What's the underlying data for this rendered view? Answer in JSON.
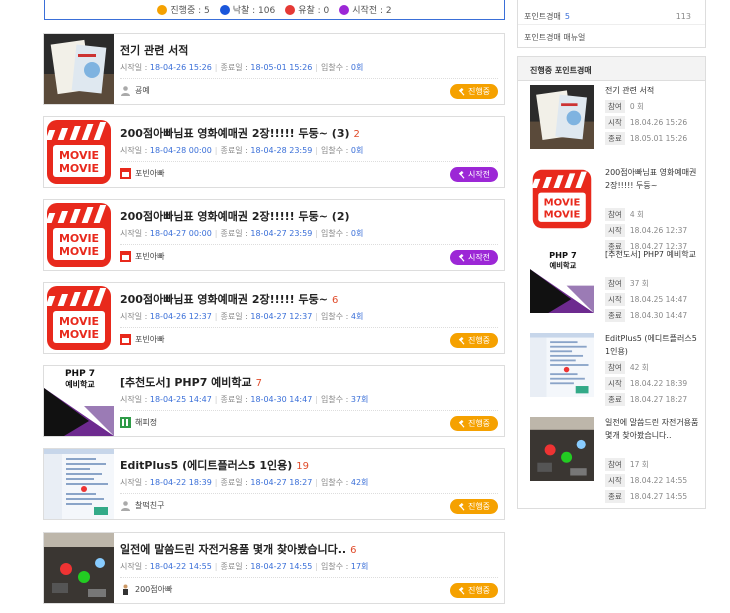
{
  "legend": {
    "items": [
      {
        "label": "진행중 : 5",
        "color": "#f5a100"
      },
      {
        "label": "낙찰 : 106",
        "color": "#1a56db"
      },
      {
        "label": "유찰 : 0",
        "color": "#e53935"
      },
      {
        "label": "시작전 : 2",
        "color": "#9c27d6"
      }
    ]
  },
  "auctions": [
    {
      "title": "전기 관련 서적",
      "count": "",
      "start_label": "시작일 :",
      "start": "18-04-26 15:26",
      "end_label": "종료일 :",
      "end": "18-05-01 15:26",
      "bids_label": "입찰수 :",
      "bids": "0회",
      "user": "굥예",
      "status": "진행중",
      "status_type": "progress",
      "thumb": "book"
    },
    {
      "title": "200점아빠님표 영화예매권 2장!!!!! 두둥~ (3)",
      "count": "2",
      "start_label": "시작일 :",
      "start": "18-04-28 00:00",
      "end_label": "종료일 :",
      "end": "18-04-28 23:59",
      "bids_label": "입찰수 :",
      "bids": "0회",
      "user": "포빈아빠",
      "status": "시작전",
      "status_type": "scheduled",
      "thumb": "movie"
    },
    {
      "title": "200점아빠님표 영화예매권 2장!!!!! 두둥~ (2)",
      "count": "",
      "start_label": "시작일 :",
      "start": "18-04-27 00:00",
      "end_label": "종료일 :",
      "end": "18-04-27 23:59",
      "bids_label": "입찰수 :",
      "bids": "0회",
      "user": "포빈아빠",
      "status": "시작전",
      "status_type": "scheduled",
      "thumb": "movie"
    },
    {
      "title": "200점아빠님표 영화예매권 2장!!!!! 두둥~",
      "count": "6",
      "start_label": "시작일 :",
      "start": "18-04-26 12:37",
      "end_label": "종료일 :",
      "end": "18-04-27 12:37",
      "bids_label": "입찰수 :",
      "bids": "4회",
      "user": "포빈아빠",
      "status": "진행중",
      "status_type": "progress",
      "thumb": "movie"
    },
    {
      "title": "[추천도서] PHP7 예비학교",
      "count": "7",
      "start_label": "시작일 :",
      "start": "18-04-25 14:47",
      "end_label": "종료일 :",
      "end": "18-04-30 14:47",
      "bids_label": "입찰수 :",
      "bids": "37회",
      "user": "해피정",
      "status": "진행중",
      "status_type": "progress",
      "thumb": "php"
    },
    {
      "title": "EditPlus5 (에디트플러스5 1인용)",
      "count": "19",
      "start_label": "시작일 :",
      "start": "18-04-22 18:39",
      "end_label": "종료일 :",
      "end": "18-04-27 18:27",
      "bids_label": "입찰수 :",
      "bids": "42회",
      "user": "찰떡친구",
      "status": "진행중",
      "status_type": "progress",
      "thumb": "editplus"
    },
    {
      "title": "일전에 말씀드린 자전거용품 몇개 찾아봤습니다..",
      "count": "6",
      "start_label": "시작일 :",
      "start": "18-04-22 14:55",
      "end_label": "종료일 :",
      "end": "18-04-27 14:55",
      "bids_label": "입찰수 :",
      "bids": "17회",
      "user": "200점아빠",
      "status": "진행중",
      "status_type": "progress",
      "thumb": "bike"
    }
  ],
  "side_top": {
    "link1": "포인트경매",
    "link1_count": "5",
    "link1_num": "113",
    "link2": "포인트경매 매뉴얼"
  },
  "side_panel": {
    "heading": "진행중 포인트경매",
    "labels": {
      "bid": "참여",
      "start": "시작",
      "end": "종료"
    },
    "items": [
      {
        "title": "전기 관련 서적",
        "bids": "0 회",
        "start": "18.04.26 15:26",
        "end": "18.05.01 15:26",
        "thumb": "book"
      },
      {
        "title": "200점아빠님표 영화예매권 2장!!!!! 두둥~",
        "bids": "4 회",
        "start": "18.04.26 12:37",
        "end": "18.04.27 12:37",
        "thumb": "movie"
      },
      {
        "title": "[추천도서] PHP7 예비학교",
        "bids": "37 회",
        "start": "18.04.25 14:47",
        "end": "18.04.30 14:47",
        "thumb": "php"
      },
      {
        "title": "EditPlus5 (에디트플러스5 1인용)",
        "bids": "42 회",
        "start": "18.04.22 18:39",
        "end": "18.04.27 18:27",
        "thumb": "editplus"
      },
      {
        "title": "일전에 말씀드린 자전거용품 몇개 찾아봤습니다..",
        "bids": "17 회",
        "start": "18.04.22 14:55",
        "end": "18.04.27 14:55",
        "thumb": "bike"
      }
    ]
  }
}
